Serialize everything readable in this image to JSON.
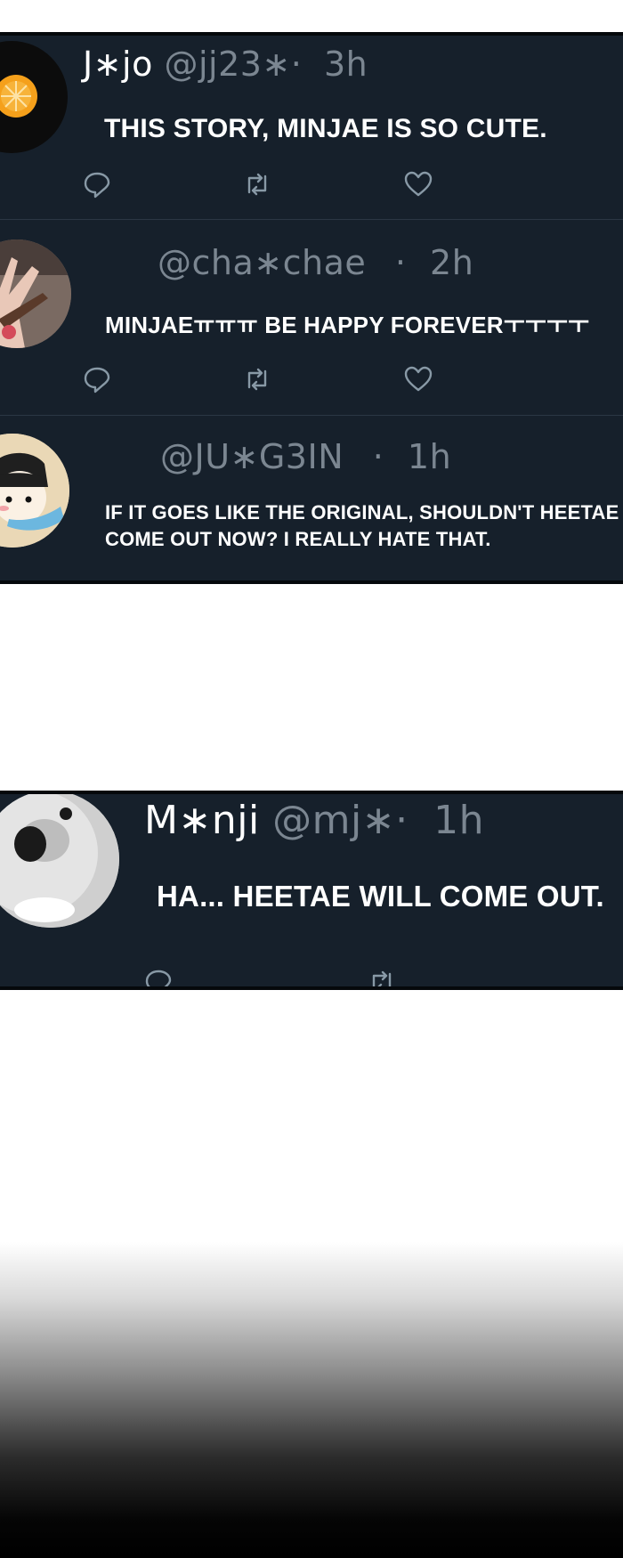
{
  "panel1": {
    "tweets": [
      {
        "name": "J∗jo",
        "handle": "@jj23∗·",
        "time": "3h",
        "text": "THIS STORY, MINJAE IS SO CUTE."
      },
      {
        "name": "",
        "handle": "@cha∗chae",
        "sep": "·",
        "time": "2h",
        "text": "MINJAEㅠㅠㅠ BE HAPPY FOREVERㅜㅜㅜㅜ"
      },
      {
        "name": "",
        "handle": "@JU∗G3IN",
        "sep": "·",
        "time": "1h",
        "text_line1": "IF IT GOES LIKE THE ORIGINAL, SHOULDN'T HEETAE",
        "text_line2": "COME OUT NOW? I REALLY HATE THAT."
      }
    ]
  },
  "panel2": {
    "tweet": {
      "name": "M∗nji",
      "handle": "@mj∗·",
      "time": "1h",
      "text": "HA... HEETAE WILL COME OUT."
    }
  },
  "icons": [
    "reply-icon",
    "retweet-icon",
    "like-icon"
  ],
  "colors": {
    "panel_bg": "#16202b",
    "handle_gray": "#7b8691",
    "divider": "#2b3744",
    "icon_gray": "#8899a6"
  }
}
